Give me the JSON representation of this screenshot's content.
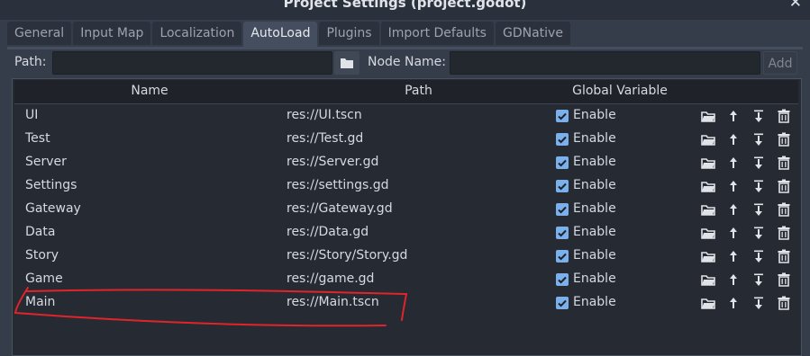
{
  "window": {
    "title": "Project Settings (project.godot)"
  },
  "tabs": [
    "General",
    "Input Map",
    "Localization",
    "AutoLoad",
    "Plugins",
    "Import Defaults",
    "GDNative"
  ],
  "toolbar": {
    "path_label": "Path:",
    "node_name_label": "Node Name:",
    "add_label": "Add",
    "path_value": "",
    "node_name_value": ""
  },
  "table": {
    "headers": {
      "name": "Name",
      "path": "Path",
      "global": "Global Variable"
    },
    "rows": [
      {
        "name": "UI",
        "path": "res://UI.tscn",
        "enable": "Enable"
      },
      {
        "name": "Test",
        "path": "res://Test.gd",
        "enable": "Enable"
      },
      {
        "name": "Server",
        "path": "res://Server.gd",
        "enable": "Enable"
      },
      {
        "name": "Settings",
        "path": "res://settings.gd",
        "enable": "Enable"
      },
      {
        "name": "Gateway",
        "path": "res://Gateway.gd",
        "enable": "Enable"
      },
      {
        "name": "Data",
        "path": "res://Data.gd",
        "enable": "Enable"
      },
      {
        "name": "Story",
        "path": "res://Story/Story.gd",
        "enable": "Enable"
      },
      {
        "name": "Game",
        "path": "res://game.gd",
        "enable": "Enable"
      },
      {
        "name": "Main",
        "path": "res://Main.tscn",
        "enable": "Enable"
      }
    ]
  },
  "colors": {
    "accent": "#7ab0ec",
    "annotation": "#e0242a"
  },
  "icons": {
    "row_actions": [
      "folder-icon",
      "move-up-icon",
      "move-down-icon",
      "trash-icon"
    ]
  }
}
